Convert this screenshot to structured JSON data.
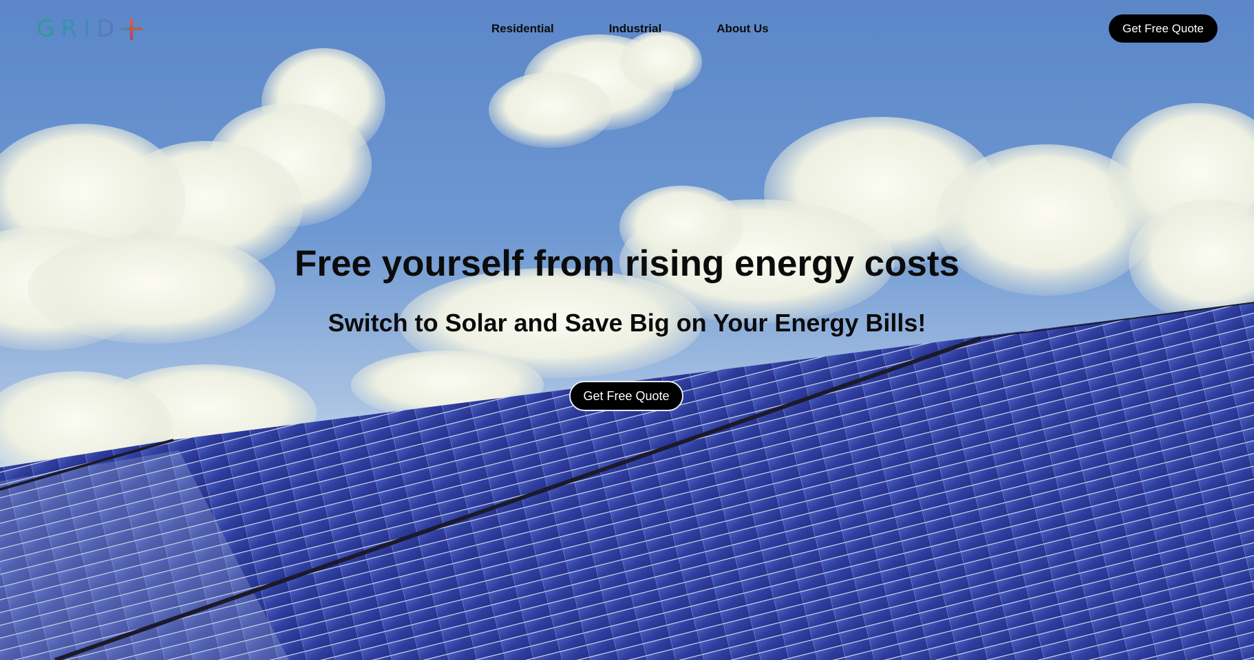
{
  "brand": {
    "logo_text": "GRID",
    "logo_icon": "plus-icon"
  },
  "nav": {
    "items": [
      {
        "label": "Residential"
      },
      {
        "label": "Industrial"
      },
      {
        "label": "About Us"
      }
    ],
    "cta_label": "Get Free Quote"
  },
  "hero": {
    "headline": "Free yourself from rising energy costs",
    "subheadline": "Switch to Solar and Save Big on Your Energy Bills!",
    "cta_label": "Get Free Quote",
    "background": "sky-with-clouds-and-solar-panels"
  },
  "colors": {
    "cta_bg": "#000000",
    "cta_text": "#ffffff",
    "text_primary": "#0b0b0b",
    "logo_teal": "#2a9d8f",
    "logo_accent": "#d0562b",
    "panel_blue": "#2a3a9a"
  }
}
